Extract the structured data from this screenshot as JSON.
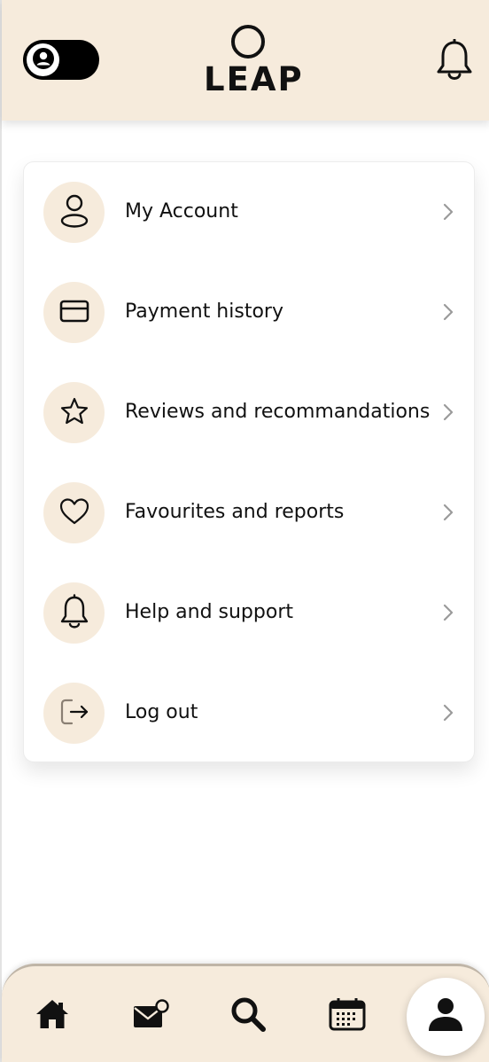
{
  "header": {
    "logo_text": "LEAP",
    "theme_toggle": {
      "state": "dark"
    },
    "notification_icon": "bell-icon"
  },
  "menu": {
    "items": [
      {
        "label": "My Account",
        "icon": "user-icon"
      },
      {
        "label": "Payment history",
        "icon": "credit-card-icon"
      },
      {
        "label": "Reviews and recommandations",
        "icon": "star-icon"
      },
      {
        "label": "Favourites and reports",
        "icon": "heart-icon"
      },
      {
        "label": "Help and support",
        "icon": "bell-icon"
      },
      {
        "label": "Log out",
        "icon": "logout-icon"
      }
    ]
  },
  "bottom_nav": {
    "items": [
      {
        "icon": "home-icon"
      },
      {
        "icon": "mail-notification-icon"
      },
      {
        "icon": "search-icon"
      },
      {
        "icon": "calendar-icon"
      },
      {
        "icon": "profile-icon",
        "active": true
      }
    ]
  },
  "colors": {
    "accent_bg": "#f6ebdc",
    "nav_border": "#bfb5a7",
    "text": "#111111"
  }
}
